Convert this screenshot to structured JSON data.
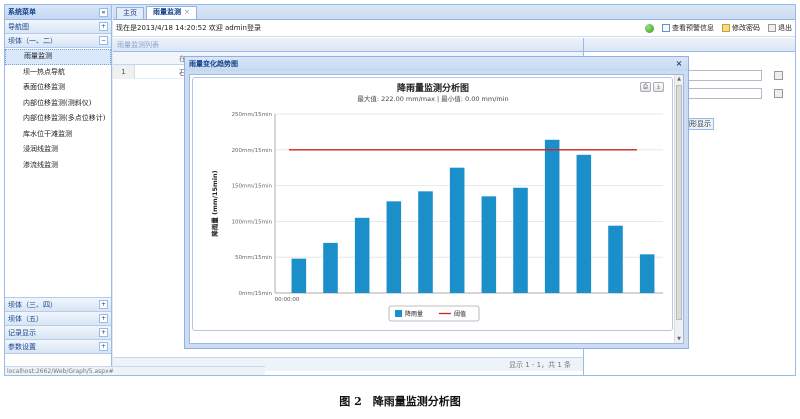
{
  "sidebar": {
    "title": "系统菜单",
    "collapse_glyph": "«",
    "top_groups": [
      {
        "label": "导航图",
        "toggle": "+"
      },
      {
        "label": "坝体（一、二）",
        "toggle": "−"
      }
    ],
    "items": [
      {
        "label": "雨量监测",
        "selected": true
      },
      {
        "label": "坝一热点导航"
      },
      {
        "label": "表面位移监测"
      },
      {
        "label": "内部位移监测(测斜仪)"
      },
      {
        "label": "内部位移监测(多点位移计)"
      },
      {
        "label": "库水位干滩监测"
      },
      {
        "label": "浸润线监测"
      },
      {
        "label": "渗流线监测"
      }
    ],
    "bottom_groups": [
      {
        "label": "坝体（三、四）",
        "toggle": "+"
      },
      {
        "label": "坝体（五）",
        "toggle": "+"
      },
      {
        "label": "记录显示",
        "toggle": "+"
      },
      {
        "label": "参数设置",
        "toggle": "+"
      }
    ]
  },
  "status_bar": "localhost:2662/Web/Graph/5.aspx#",
  "tabs": [
    {
      "label": "主页",
      "active": false
    },
    {
      "label": "雨量监测",
      "active": true,
      "close": "×"
    }
  ],
  "topbar": {
    "welcome": "现在是2013/4/18 14:20:52 欢迎 admin登录",
    "links": [
      {
        "label": "查看预警信息",
        "icon": "alert-icon"
      },
      {
        "label": "修改密码",
        "icon": "key-icon"
      },
      {
        "label": "退出",
        "icon": "exit-icon"
      }
    ]
  },
  "grid": {
    "title": "雨量监测列表",
    "header_fragment": "在",
    "row_number": "1",
    "row_fragment": "石",
    "pager_info": "显示 1 - 1，共 1 条"
  },
  "right_panel": {
    "button_label": "图形显示"
  },
  "window": {
    "title": "雨量变化趋势图",
    "close": "×",
    "scroll_up": "▲",
    "scroll_down": "▼"
  },
  "chart_tools": [
    "⎙",
    "⤓"
  ],
  "chart_data": {
    "type": "bar",
    "title": "降雨量监测分析图",
    "subtitle": "最大值: 222.00 mm/max | 最小值: 0.00 mm/min",
    "ylabel": "降雨量 (mm/15min)",
    "ylim": [
      0,
      250
    ],
    "y_ticks": [
      "0mm/15min",
      "50mm/15min",
      "100mm/15min",
      "150mm/15min",
      "200mm/15min",
      "250mm/15min"
    ],
    "x_ticks": [
      "00:00:00"
    ],
    "grid": true,
    "series": [
      {
        "name": "降雨量",
        "color": "#1b8fc9",
        "values": [
          48,
          70,
          105,
          128,
          142,
          175,
          135,
          147,
          214,
          193,
          94,
          54
        ]
      }
    ],
    "threshold": {
      "name": "阈值",
      "value": 200,
      "color": "#cc2222"
    },
    "legend_position": "bottom"
  },
  "caption": "图 2　降雨量监测分析图"
}
